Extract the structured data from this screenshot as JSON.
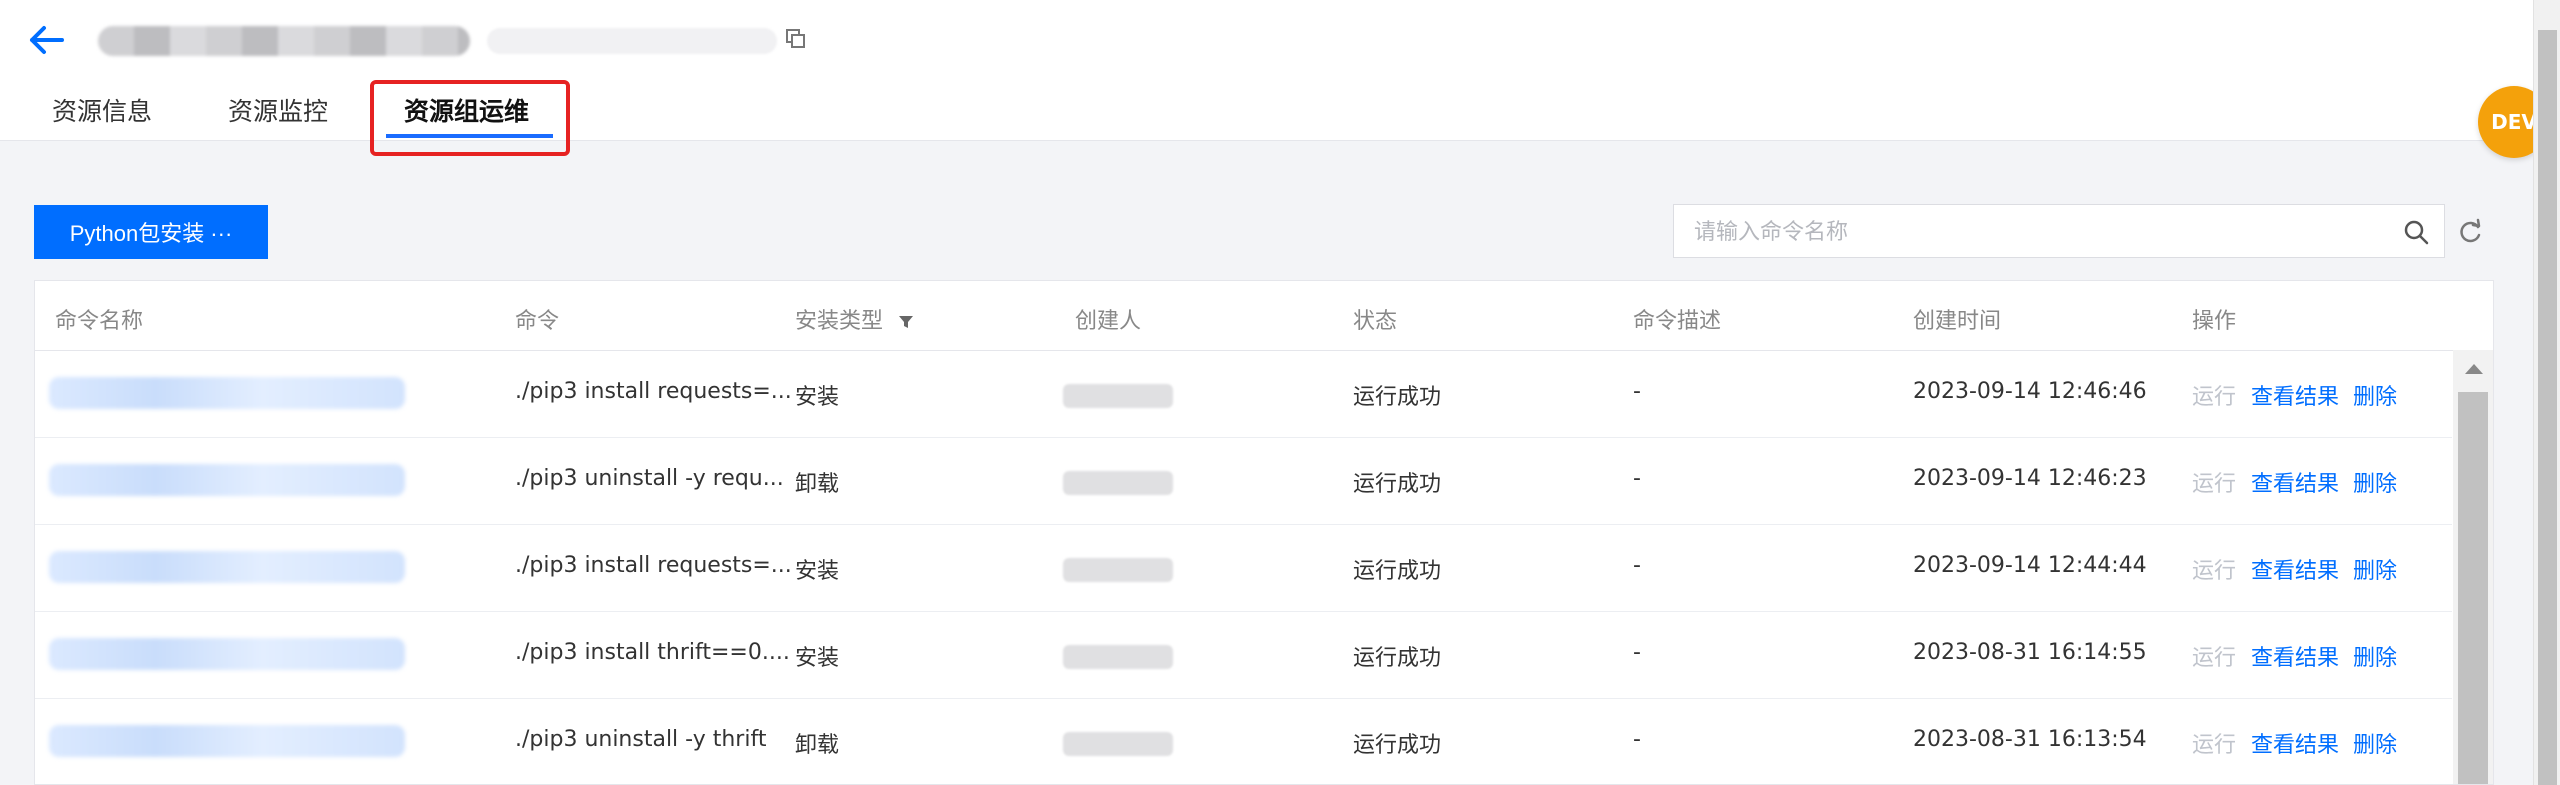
{
  "header": {
    "back_icon": "arrow-left-icon",
    "copy_icon": "copy-icon",
    "accent": "#006eff"
  },
  "tabs": [
    {
      "label": "资源信息",
      "active": false
    },
    {
      "label": "资源监控",
      "active": false
    },
    {
      "label": "资源组运维",
      "active": true
    }
  ],
  "badge": {
    "label": "DEV",
    "color": "#f4a10b"
  },
  "toolbar": {
    "primary_label": "Python包安装 ···"
  },
  "search": {
    "placeholder": "请输入命令名称",
    "value": ""
  },
  "table": {
    "columns": [
      "命令名称",
      "命令",
      "安装类型",
      "创建人",
      "状态",
      "命令描述",
      "创建时间",
      "操作"
    ],
    "rows": [
      {
        "command": "./pip3 install requests=...",
        "type": "安装",
        "status": "运行成功",
        "desc": "-",
        "time": "2023-09-14 12:46:46"
      },
      {
        "command": "./pip3 uninstall -y requ...",
        "type": "卸载",
        "status": "运行成功",
        "desc": "-",
        "time": "2023-09-14 12:46:23"
      },
      {
        "command": "./pip3 install requests=...",
        "type": "安装",
        "status": "运行成功",
        "desc": "-",
        "time": "2023-09-14 12:44:44"
      },
      {
        "command": "./pip3 install thrift==0....",
        "type": "安装",
        "status": "运行成功",
        "desc": "-",
        "time": "2023-08-31 16:14:55"
      },
      {
        "command": "./pip3 uninstall -y thrift",
        "type": "卸载",
        "status": "运行成功",
        "desc": "-",
        "time": "2023-08-31 16:13:54"
      }
    ],
    "actions": {
      "run": "运行",
      "view": "查看结果",
      "delete": "删除"
    }
  }
}
